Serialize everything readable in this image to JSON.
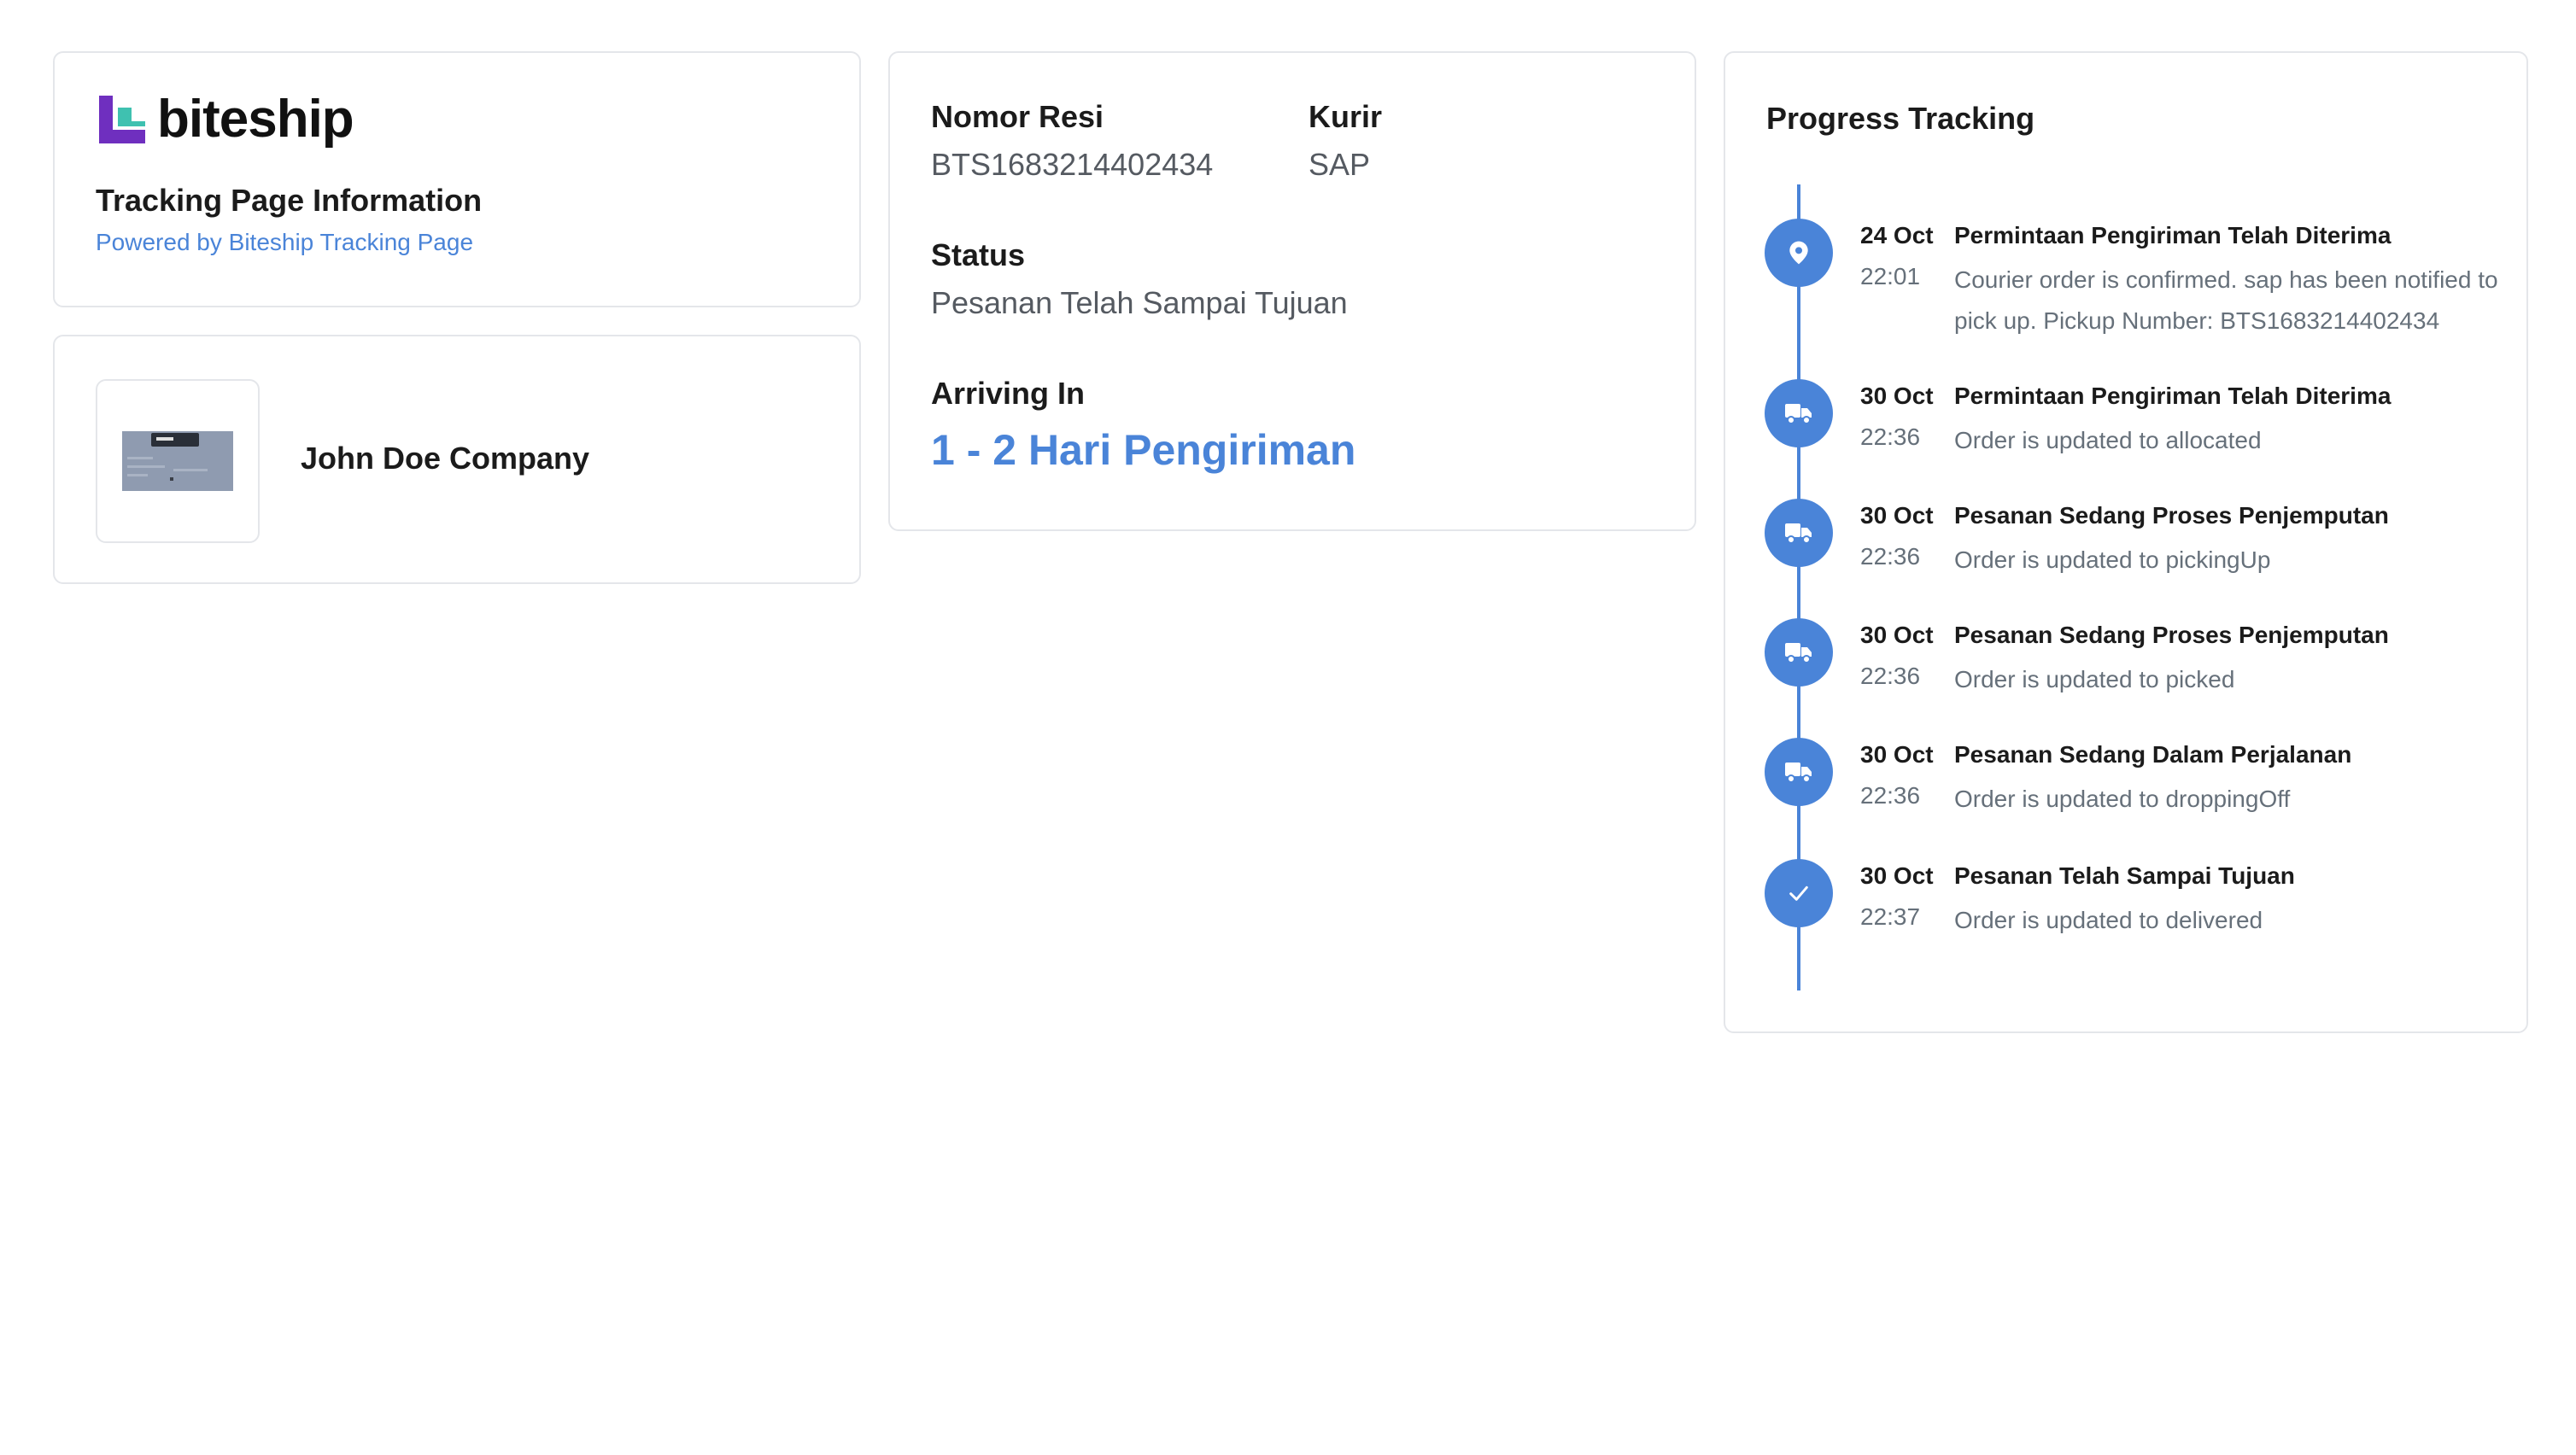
{
  "brand": {
    "name": "biteship",
    "title": "Tracking Page Information",
    "powered_by": "Powered by Biteship Tracking Page",
    "colors": {
      "logo_purple": "#6f2fbf",
      "logo_teal": "#3fc1b0",
      "accent": "#4a84d8"
    }
  },
  "company": {
    "name": "John Doe Company",
    "logo_icon": "company-logo-image"
  },
  "shipment": {
    "resi_label": "Nomor Resi",
    "resi_value": "BTS1683214402434",
    "courier_label": "Kurir",
    "courier_value": "SAP",
    "status_label": "Status",
    "status_value": "Pesanan Telah Sampai Tujuan",
    "arrival_label": "Arriving In",
    "arrival_value": "1 - 2 Hari Pengiriman"
  },
  "progress": {
    "title": "Progress Tracking",
    "events": [
      {
        "date": "24 Oct",
        "time": "22:01",
        "title": "Permintaan Pengiriman Telah Diterima",
        "description": "Courier order is confirmed. sap has been notified to pick up. Pickup Number: BTS1683214402434",
        "icon": "location-pin-icon"
      },
      {
        "date": "30 Oct",
        "time": "22:36",
        "title": "Permintaan Pengiriman Telah Diterima",
        "description": "Order is updated to allocated",
        "icon": "truck-icon"
      },
      {
        "date": "30 Oct",
        "time": "22:36",
        "title": "Pesanan Sedang Proses Penjemputan",
        "description": "Order is updated to pickingUp",
        "icon": "truck-icon"
      },
      {
        "date": "30 Oct",
        "time": "22:36",
        "title": "Pesanan Sedang Proses Penjemputan",
        "description": "Order is updated to picked",
        "icon": "truck-icon"
      },
      {
        "date": "30 Oct",
        "time": "22:36",
        "title": "Pesanan Sedang Dalam Perjalanan",
        "description": "Order is updated to droppingOff",
        "icon": "truck-icon"
      },
      {
        "date": "30 Oct",
        "time": "22:37",
        "title": "Pesanan Telah Sampai Tujuan",
        "description": "Order is updated to delivered",
        "icon": "checkmark-icon"
      }
    ]
  }
}
